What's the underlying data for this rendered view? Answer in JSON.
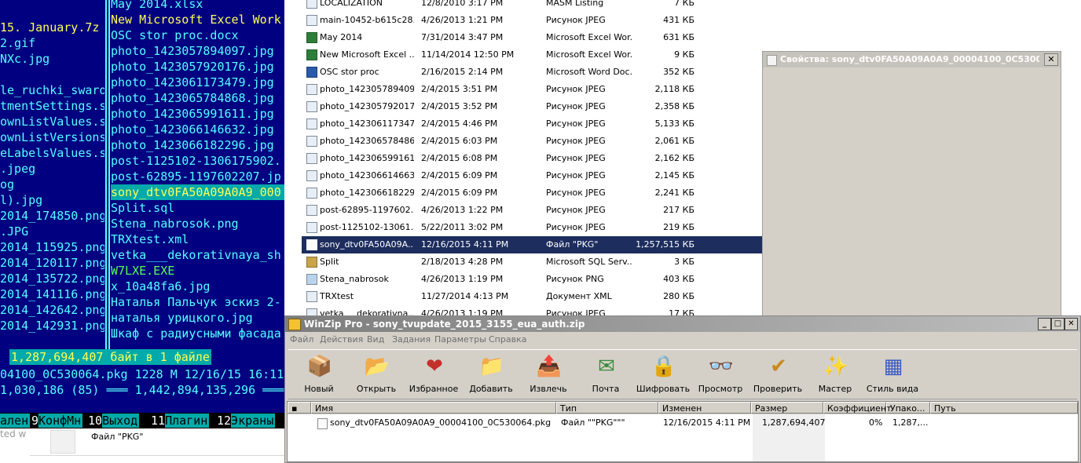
{
  "far": {
    "left_rows": [
      "15. January.7z",
      "2.gif",
      "NXc.jpg",
      "",
      "le_ruchki_swaro}",
      "tmentSettings.s}",
      "ownListValues.s}",
      "ownListVersions}",
      "eLabelsValues.s}",
      ".jpeg",
      "og",
      "l).jpg",
      "2014_174850.png",
      ".JPG",
      "2014_115925.png",
      "2014_120117.png",
      "2014_135722.png",
      "2014_141116.png",
      "2014_142642.png",
      "2014_142931.png"
    ],
    "right_rows": [
      "May 2014.xlsx",
      "New Microsoft Excel Work",
      "OSC stor proc.docx",
      "photo_1423057894097.jpg",
      "photo_1423057920176.jpg",
      "photo_1423061173479.jpg",
      "photo_1423065784868.jpg",
      "photo_1423065991611.jpg",
      "photo_1423066146632.jpg",
      "photo_1423066182296.jpg",
      "post-1125102-1306175902.",
      "post-62895-1197602207.jp",
      "sony_dtv0FA50A09A0A9_000",
      "Split.sql",
      "Stena_nabrosok.png",
      "TRXtest.xml",
      "vetka___dekorativnaya_sh",
      "W7LXE.EXE",
      "x_10a48fa6.jpg",
      "Наталья Пальчук эскиз 2-",
      "наталья урицкого.jpg",
      "Шкаф с радиусными фасада"
    ],
    "info_selected": "1,287,694,407 байт в 1 файле",
    "info_line2": "04100_0C530064.pkg 1228 M 12/16/15 16:11",
    "info_line3": "1,030,186 (85) ═══ 1,442,894,135,296 ═══",
    "keys": [
      {
        "num": "",
        "label": "ален"
      },
      {
        "num": "9",
        "label": "КонфМн"
      },
      {
        "num": "10",
        "label": "Выход"
      },
      {
        "num": "11",
        "label": "Плагин"
      },
      {
        "num": "12",
        "label": "Экраны"
      }
    ],
    "bottom_text": "ted w",
    "bottom_doc_label": "Файл \"PKG\""
  },
  "explorer": {
    "rows": [
      {
        "icon": "file-icon",
        "name": "LOCALIZATION",
        "date": "12/8/2010 3:17 PM",
        "type": "MASM Listing",
        "size": "7 КБ"
      },
      {
        "icon": "image-icon",
        "name": "main-10452-b615c28...",
        "date": "4/26/2013 1:21 PM",
        "type": "Рисунок JPEG",
        "size": "431 КБ"
      },
      {
        "icon": "excel-icon",
        "name": "May 2014",
        "date": "7/31/2014 3:47 PM",
        "type": "Microsoft Excel Wor...",
        "size": "631 КБ"
      },
      {
        "icon": "excel-icon",
        "name": "New Microsoft Excel ...",
        "date": "11/14/2014 12:50 PM",
        "type": "Microsoft Excel Wor...",
        "size": "9 КБ"
      },
      {
        "icon": "word-icon",
        "name": "OSC stor proc",
        "date": "2/16/2015 2:14 PM",
        "type": "Microsoft Word Doc...",
        "size": "352 КБ"
      },
      {
        "icon": "image-icon",
        "name": "photo_1423057894097",
        "date": "2/4/2015 3:51 PM",
        "type": "Рисунок JPEG",
        "size": "2,118 КБ"
      },
      {
        "icon": "image-icon",
        "name": "photo_1423057920176",
        "date": "2/4/2015 3:52 PM",
        "type": "Рисунок JPEG",
        "size": "2,358 КБ"
      },
      {
        "icon": "image-icon",
        "name": "photo_1423061173479",
        "date": "2/4/2015 4:46 PM",
        "type": "Рисунок JPEG",
        "size": "5,133 КБ"
      },
      {
        "icon": "image-icon",
        "name": "photo_1423065784868",
        "date": "2/4/2015 6:03 PM",
        "type": "Рисунок JPEG",
        "size": "2,061 КБ"
      },
      {
        "icon": "image-icon",
        "name": "photo_1423065991611",
        "date": "2/4/2015 6:08 PM",
        "type": "Рисунок JPEG",
        "size": "2,162 КБ"
      },
      {
        "icon": "image-icon",
        "name": "photo_1423066146632",
        "date": "2/4/2015 6:09 PM",
        "type": "Рисунок JPEG",
        "size": "2,145 КБ"
      },
      {
        "icon": "image-icon",
        "name": "photo_1423066182296",
        "date": "2/4/2015 6:09 PM",
        "type": "Рисунок JPEG",
        "size": "2,241 КБ"
      },
      {
        "icon": "image-icon",
        "name": "post-62895-1197602...",
        "date": "4/26/2013 1:22 PM",
        "type": "Рисунок JPEG",
        "size": "217 КБ"
      },
      {
        "icon": "image-icon",
        "name": "post-1125102-13061...",
        "date": "5/22/2011 3:02 PM",
        "type": "Рисунок JPEG",
        "size": "219 КБ"
      },
      {
        "icon": "pkg-file-icon",
        "name": "sony_dtv0FA50A09A...",
        "date": "12/16/2015 4:11 PM",
        "type": "Файл \"PKG\"",
        "size": "1,257,515 КБ",
        "selected": true
      },
      {
        "icon": "sql-icon",
        "name": "Split",
        "date": "2/18/2013 4:28 PM",
        "type": "Microsoft SQL Serv...",
        "size": "3 КБ"
      },
      {
        "icon": "png-icon",
        "name": "Stena_nabrosok",
        "date": "4/26/2013 1:19 PM",
        "type": "Рисунок PNG",
        "size": "403 КБ"
      },
      {
        "icon": "xml-icon",
        "name": "TRXtest",
        "date": "11/27/2014 4:13 PM",
        "type": "Документ XML",
        "size": "280 КБ"
      },
      {
        "icon": "image-icon",
        "name": "vetka___dekorativna...",
        "date": "4/26/2013 1:19 PM",
        "type": "Рисунок JPEG",
        "size": "17 КБ"
      }
    ]
  },
  "props": {
    "title": "Свойства: sony_dtv0FA50A09A0A9_00004100_0C530064...",
    "close": "✕"
  },
  "winzip": {
    "title": "WinZip Pro - sony_tvupdate_2015_3155_eua_auth.zip",
    "btn_min": "_",
    "btn_max": "□",
    "btn_close": "✕",
    "menu": [
      "Файл",
      "Действия",
      "Вид",
      "Задания",
      "Параметры",
      "Справка"
    ],
    "toolbar": [
      {
        "label": "Новый",
        "icon": "new-archive-icon",
        "glyph": "📦"
      },
      {
        "label": "Открыть",
        "icon": "open-archive-icon",
        "glyph": "📂"
      },
      {
        "label": "Избранное",
        "icon": "favorites-icon",
        "glyph": "❤"
      },
      {
        "label": "Добавить",
        "icon": "add-files-icon",
        "glyph": "📁"
      },
      {
        "label": "Извлечь",
        "icon": "extract-icon",
        "glyph": "📤"
      },
      {
        "label": "Почта",
        "icon": "mail-icon",
        "glyph": "✉"
      },
      {
        "label": "Шифровать",
        "icon": "encrypt-icon",
        "glyph": "🔒"
      },
      {
        "label": "Просмотр",
        "icon": "view-icon",
        "glyph": "👓"
      },
      {
        "label": "Проверить",
        "icon": "check-icon",
        "glyph": "✔"
      },
      {
        "label": "Мастер",
        "icon": "wizard-icon",
        "glyph": "✨"
      },
      {
        "label": "Стиль вида",
        "icon": "view-style-icon",
        "glyph": "▦"
      }
    ],
    "columns": [
      "Имя",
      "Тип",
      "Изменен",
      "Размер",
      "Коэффициент",
      "Упако...",
      "Путь"
    ],
    "rows": [
      {
        "name": "sony_dtv0FA50A09A0A9_00004100_0C530064.pkg",
        "type": "Файл \"\"PKG\"\"\"",
        "modified": "12/16/2015 4:11 PM",
        "size": "1,287,694,407",
        "ratio": "0%",
        "packed": "1,287,..."
      }
    ]
  },
  "colors": {
    "far_bg": "#000080",
    "far_text": "#55ffff",
    "far_highlight": "#00aaaa",
    "explorer_selection": "#1d2d5e",
    "dialog_gray": "#d4d0c8"
  }
}
